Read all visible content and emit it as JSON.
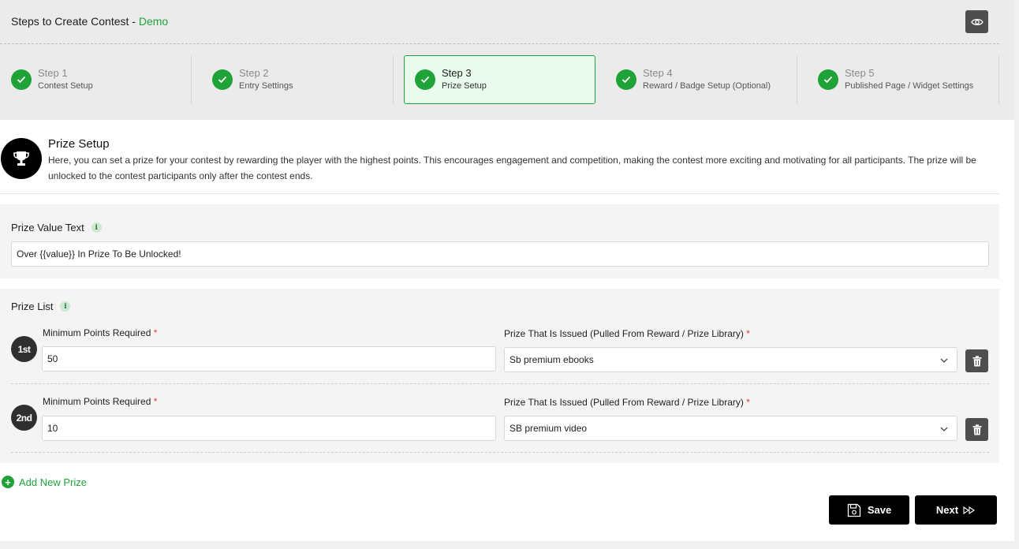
{
  "header": {
    "title": "Steps to Create Contest - ",
    "contest_name": "Demo"
  },
  "steps": [
    {
      "number": "Step 1",
      "name": "Contest Setup",
      "completed": true,
      "active": false
    },
    {
      "number": "Step 2",
      "name": "Entry Settings",
      "completed": true,
      "active": false
    },
    {
      "number": "Step 3",
      "name": "Prize Setup",
      "completed": true,
      "active": true
    },
    {
      "number": "Step 4",
      "name": "Reward / Badge Setup (Optional)",
      "completed": true,
      "active": false
    },
    {
      "number": "Step 5",
      "name": "Published Page / Widget Settings",
      "completed": true,
      "active": false
    }
  ],
  "section": {
    "title": "Prize Setup",
    "description": "Here, you can set a prize for your contest by rewarding the player with the highest points. This encourages engagement and competition, making the contest more exciting and motivating for all participants. The prize will be unlocked to the contest participants only after the contest ends."
  },
  "prize_value": {
    "label": "Prize Value Text",
    "info": "i",
    "value": "Over {{value}} In Prize To Be Unlocked!"
  },
  "prize_list": {
    "label": "Prize List",
    "info": "i",
    "items": [
      {
        "rank": "1st",
        "points_label": "Minimum Points Required",
        "points_value": "50",
        "prize_label": "Prize That Is Issued (Pulled From Reward / Prize Library)",
        "prize_value": "Sb premium ebooks"
      },
      {
        "rank": "2nd",
        "points_label": "Minimum Points Required",
        "points_value": "10",
        "prize_label": "Prize That Is Issued (Pulled From Reward / Prize Library)",
        "prize_value": "SB premium video"
      }
    ],
    "required_mark": "*"
  },
  "add_prize_label": "Add New Prize",
  "buttons": {
    "save": "Save",
    "next": "Next"
  },
  "colors": {
    "accent": "#1fa339",
    "active_step_bg": "#e9fbec",
    "dark_button": "#000000",
    "icon_button": "#4e4e4e"
  }
}
